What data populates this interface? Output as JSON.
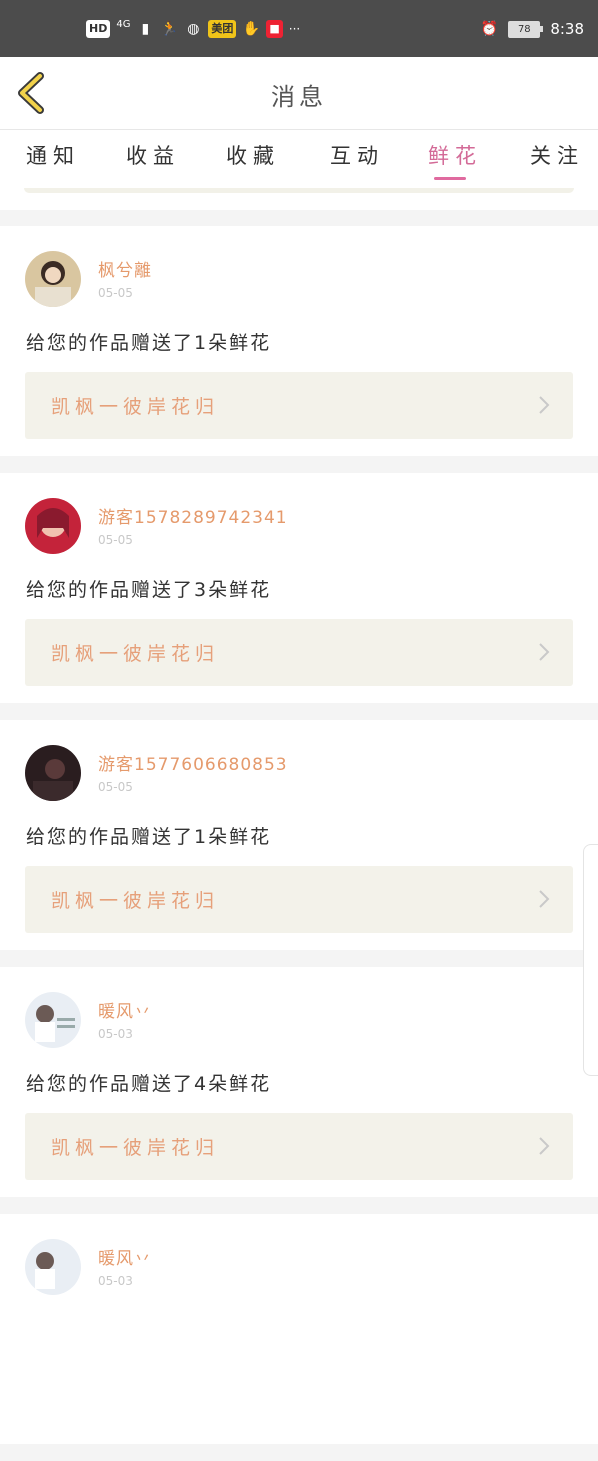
{
  "status_bar": {
    "left_chips": [
      "HD",
      "4G",
      "美团"
    ],
    "more": "···",
    "battery": "78",
    "time": "8:38"
  },
  "header": {
    "back_icon": "chevron-left-icon",
    "title": "消息"
  },
  "tabs": [
    {
      "label": "通知",
      "active": false
    },
    {
      "label": "收益",
      "active": false
    },
    {
      "label": "收藏",
      "active": false
    },
    {
      "label": "互动",
      "active": false
    },
    {
      "label": "鲜花",
      "active": true
    },
    {
      "label": "关注",
      "active": false
    }
  ],
  "colors": {
    "accent": "#e06a9f",
    "username": "#e59a6c",
    "work_title": "#e6a07a",
    "work_bg": "#f3f2ea"
  },
  "items": [
    {
      "user": "枫兮離",
      "date": "05-05",
      "message": "给您的作品赠送了1朵鲜花",
      "work": "凯枫一彼岸花归"
    },
    {
      "user": "游客1578289742341",
      "date": "05-05",
      "message": "给您的作品赠送了3朵鲜花",
      "work": "凯枫一彼岸花归"
    },
    {
      "user": "游客1577606680853",
      "date": "05-05",
      "message": "给您的作品赠送了1朵鲜花",
      "work": "凯枫一彼岸花归"
    },
    {
      "user": "暖风丷",
      "date": "05-03",
      "message": "给您的作品赠送了4朵鲜花",
      "work": "凯枫一彼岸花归"
    },
    {
      "user": "暖风丷",
      "date": "05-03",
      "message": "",
      "work": ""
    }
  ]
}
